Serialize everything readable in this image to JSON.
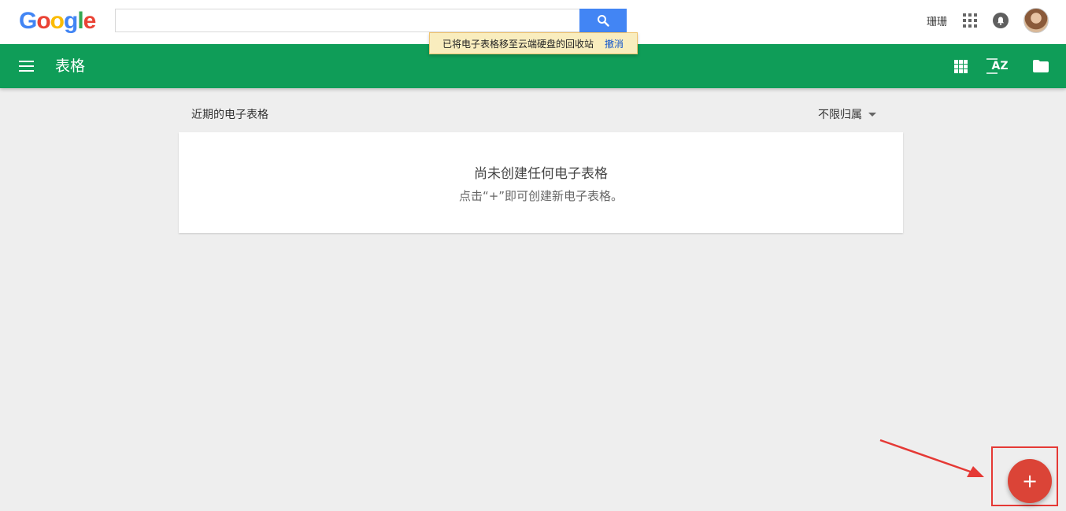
{
  "google_bar": {
    "logo_letters": [
      "G",
      "o",
      "o",
      "g",
      "l",
      "e"
    ],
    "logo_colors": [
      "#4285f4",
      "#ea4335",
      "#fbbc05",
      "#4285f4",
      "#34a853",
      "#ea4335"
    ],
    "search": {
      "value": "",
      "placeholder": ""
    },
    "search_icon": "search-icon",
    "user_name": "珊珊",
    "apps_icon": "apps-grid-icon",
    "notifications_icon": "bell-icon"
  },
  "toast": {
    "message": "已将电子表格移至云端硬盘的回收站",
    "undo_label": "撤消"
  },
  "app_bar": {
    "title": "表格",
    "background": "#0f9d58",
    "menu_icon": "hamburger-menu-icon",
    "actions": [
      "grid-view-icon",
      "sort-az-icon",
      "folder-icon"
    ],
    "sort_label": "AZ"
  },
  "main": {
    "section_title": "近期的电子表格",
    "owner_filter": "不限归属",
    "empty_title": "尚未创建任何电子表格",
    "empty_subtitle": "点击“+”即可创建新电子表格。"
  },
  "fab": {
    "label": "+",
    "color": "#db4437"
  },
  "annotation": {
    "color": "#e53935"
  }
}
